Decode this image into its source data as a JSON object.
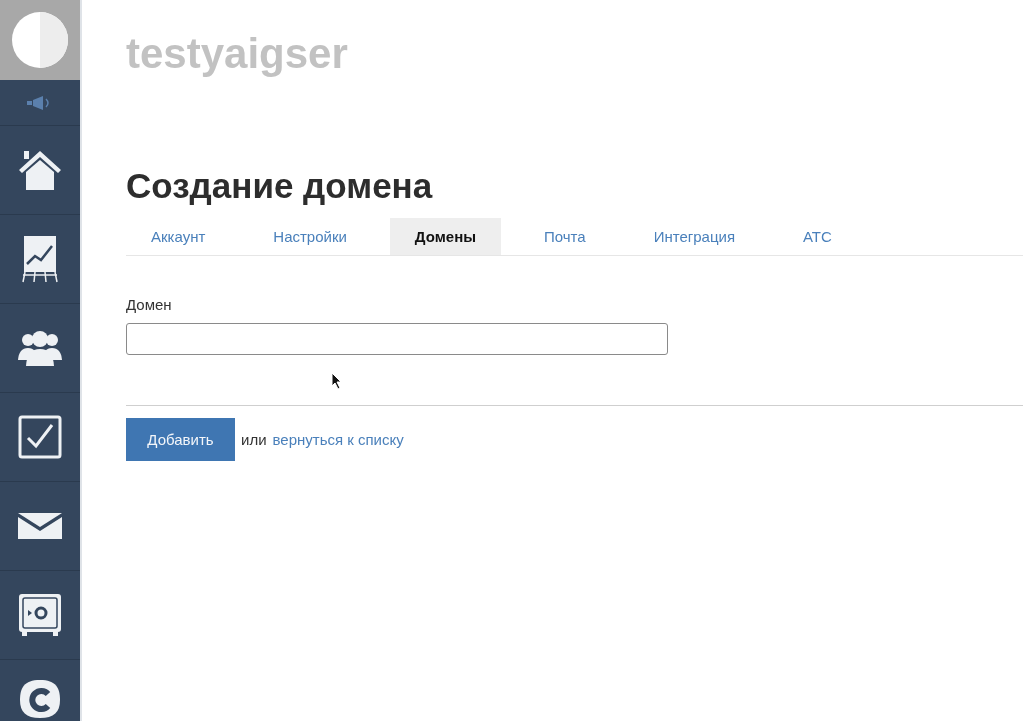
{
  "sidebar": {
    "items": [
      {
        "kind": "speaker"
      },
      {
        "kind": "home"
      },
      {
        "kind": "chart"
      },
      {
        "kind": "people"
      },
      {
        "kind": "check"
      },
      {
        "kind": "mail"
      },
      {
        "kind": "safe"
      },
      {
        "kind": "logo"
      }
    ]
  },
  "account_name": "testyaigser",
  "heading": "Создание домена",
  "tabs": [
    {
      "label": "Аккаунт",
      "selected": false
    },
    {
      "label": "Настройки",
      "selected": false
    },
    {
      "label": "Домены",
      "selected": true
    },
    {
      "label": "Почта",
      "selected": false
    },
    {
      "label": "Интеграция",
      "selected": false
    },
    {
      "label": "АТС",
      "selected": false
    }
  ],
  "form": {
    "field_label": "Домен",
    "submit": "Добавить",
    "or": "или",
    "back_link": "вернуться к списку"
  }
}
